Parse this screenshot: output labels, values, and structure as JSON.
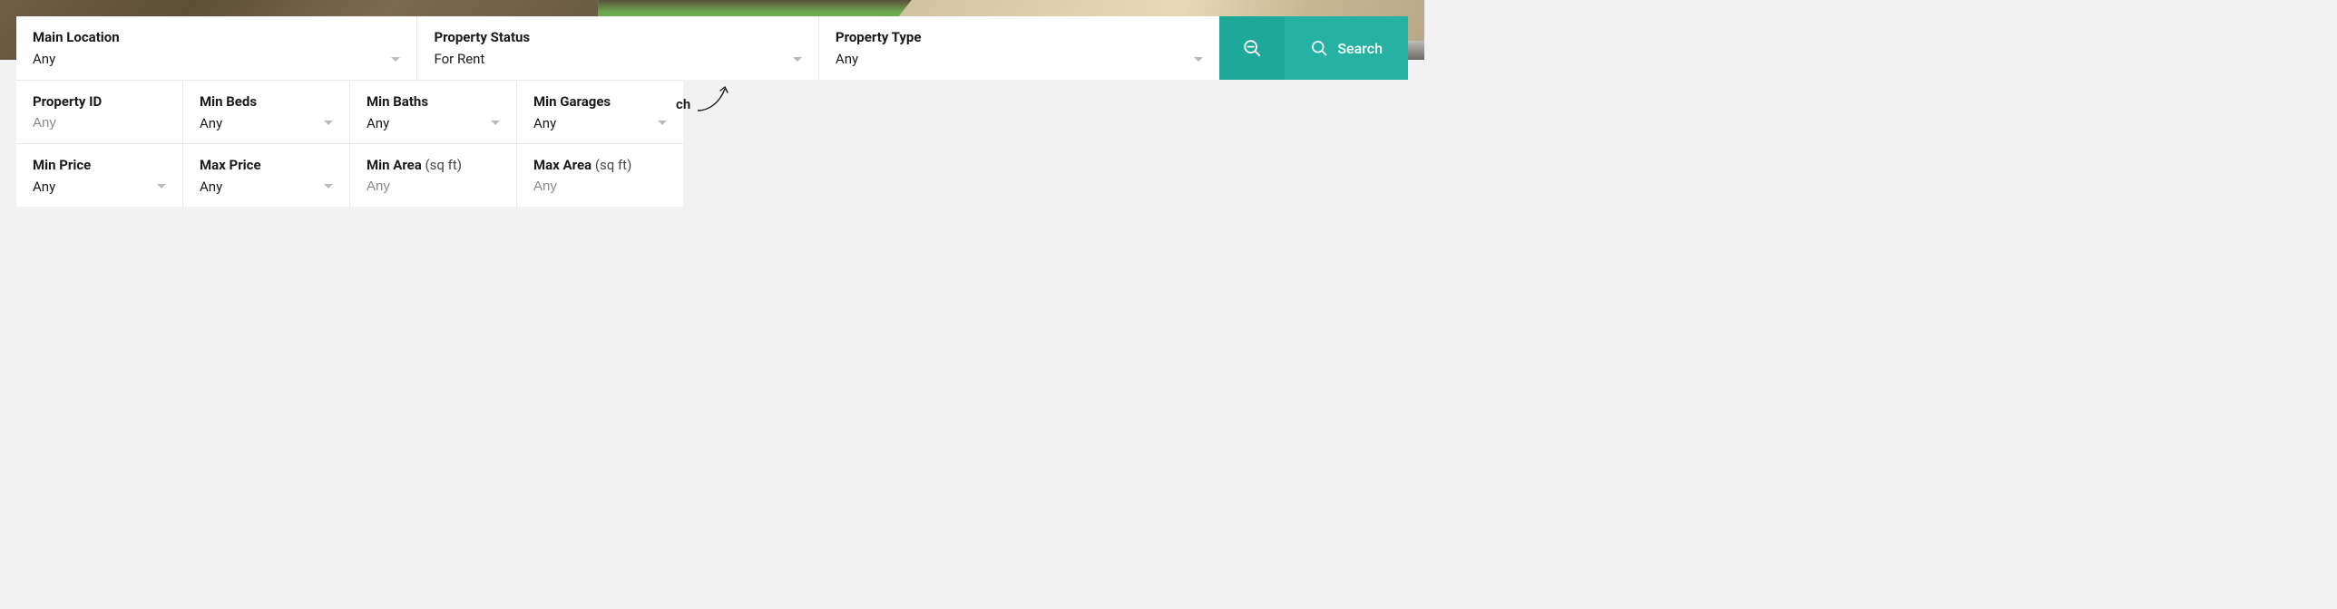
{
  "colors": {
    "accent": "#25b2a3",
    "accentDark": "#1ea89a"
  },
  "top": {
    "location": {
      "label": "Main Location",
      "value": "Any"
    },
    "status": {
      "label": "Property Status",
      "value": "For Rent"
    },
    "type": {
      "label": "Property Type",
      "value": "Any"
    },
    "searchLabel": "Search"
  },
  "exp": {
    "propertyId": {
      "label": "Property ID",
      "placeholder": "Any"
    },
    "minBeds": {
      "label": "Min Beds",
      "value": "Any"
    },
    "minBaths": {
      "label": "Min Baths",
      "value": "Any"
    },
    "minGarages": {
      "label": "Min Garages",
      "value": "Any"
    },
    "minPrice": {
      "label": "Min Price",
      "value": "Any"
    },
    "maxPrice": {
      "label": "Max Price",
      "value": "Any"
    },
    "minArea": {
      "label": "Min Area",
      "unit": "(sq ft)",
      "placeholder": "Any"
    },
    "maxArea": {
      "label": "Max Area",
      "unit": "(sq ft)",
      "placeholder": "Any"
    }
  },
  "hint": "ch"
}
